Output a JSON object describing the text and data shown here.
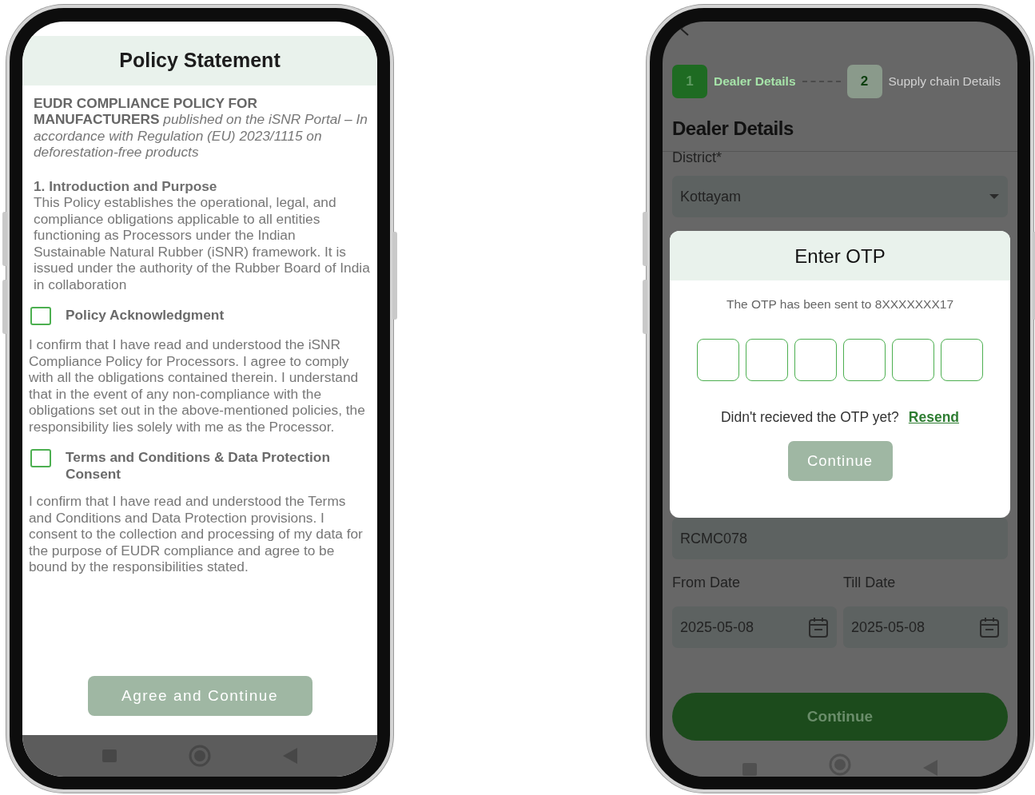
{
  "policy_screen": {
    "title": "Policy Statement",
    "intro": "**EUDR COMPLIANCE POLICY FOR MANUFACTURERS** *published on the iSNR Portal – In accordance with Regulation (EU) 2023/1115 on deforestation-free products*",
    "section_heading": "1. Introduction and Purpose",
    "section_body": "This Policy establishes the operational, legal, and compliance obligations applicable to all entities functioning as Processors under the Indian Sustainable Natural Rubber (iSNR) framework. It is issued under the authority of the Rubber Board of India in collaboration",
    "consents": [
      {
        "label": "Policy Acknowledgment",
        "checked": false,
        "text": "I confirm that I have read and understood the iSNR Compliance Policy for Processors. I agree to comply with all the obligations contained therein. I understand that in the event of any non-compliance with the obligations set out in the above-mentioned policies, the responsibility lies solely with me as the Processor."
      },
      {
        "label": "Terms and Conditions & Data Protection Consent",
        "checked": false,
        "text": "I confirm that I have read and understood the Terms and Conditions and Data Protection provisions. I consent to the collection and processing of my data for the purpose of EUDR compliance and agree to be bound by the responsibilities stated."
      }
    ],
    "agree_button": {
      "label": "Agree and Continue",
      "disabled": true
    }
  },
  "dealer_screen": {
    "steps": [
      {
        "number": "1",
        "label": "Dealer Details",
        "selected": true
      },
      {
        "number": "2",
        "label": "Supply chain Details",
        "selected": false
      }
    ],
    "heading": "Dealer Details",
    "district": {
      "label": "District*",
      "value": "Kottayam"
    },
    "code_field": {
      "value": "RCMC078"
    },
    "date_fields": [
      {
        "label": "From Date",
        "value": "2025-05-08"
      },
      {
        "label": "Till Date",
        "value": "2025-05-08"
      }
    ],
    "continue_button": "Continue"
  },
  "otp_dialog": {
    "title": "Enter OTP",
    "message": "The OTP has been sent to 8XXXXXXX17",
    "otp_boxes": [
      {
        "filled": false
      },
      {
        "filled": false
      },
      {
        "filled": false
      },
      {
        "filled": false
      },
      {
        "filled": false
      },
      {
        "filled": false
      }
    ],
    "resend_prompt": "Didn't recieved the OTP yet?",
    "resend_link": "Resend",
    "continue_button": {
      "label": "Continue",
      "disabled": true
    }
  }
}
